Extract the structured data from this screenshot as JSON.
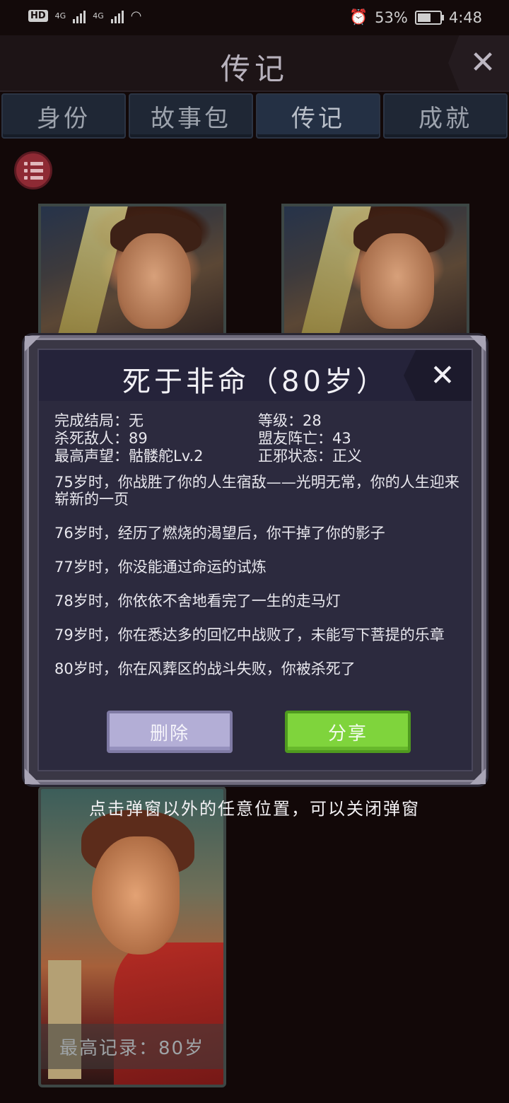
{
  "status_bar": {
    "left_badge": "HD",
    "network_1": "4G",
    "network_2": "4G",
    "battery_percent": "53%",
    "time": "4:48"
  },
  "header": {
    "title": "传记",
    "close": "✕"
  },
  "tabs": [
    {
      "label": "身份"
    },
    {
      "label": "故事包"
    },
    {
      "label": "传记"
    },
    {
      "label": "成就"
    }
  ],
  "modal": {
    "title": "死于非命（80岁）",
    "close": "✕",
    "stats": [
      {
        "label": "完成结局：无"
      },
      {
        "label": "等级：28"
      },
      {
        "label": "杀死敌人：89"
      },
      {
        "label": "盟友阵亡：43"
      },
      {
        "label": "最高声望：骷髅舵Lv.2"
      },
      {
        "label": "正邪状态：正义"
      }
    ],
    "story": [
      "75岁时，你战胜了你的人生宿敌——光明无常，你的人生迎来崭新的一页",
      "76岁时，经历了燃烧的渴望后，你干掉了你的影子",
      "77岁时，你没能通过命运的试炼",
      "78岁时，你依依不舍地看完了一生的走马灯",
      "79岁时，你在悉达多的回忆中战败了，未能写下菩提的乐章",
      "80岁时，你在风葬区的战斗失败，你被杀死了"
    ],
    "delete_label": "删除",
    "share_label": "分享"
  },
  "hint": "点击弹窗以外的任意位置，可以关闭弹窗",
  "card_record": "最高记录：80岁",
  "colors": {
    "share_green": "#7fd43c",
    "delete_purple": "#b3aed6",
    "menu_red": "#8e2a34"
  }
}
